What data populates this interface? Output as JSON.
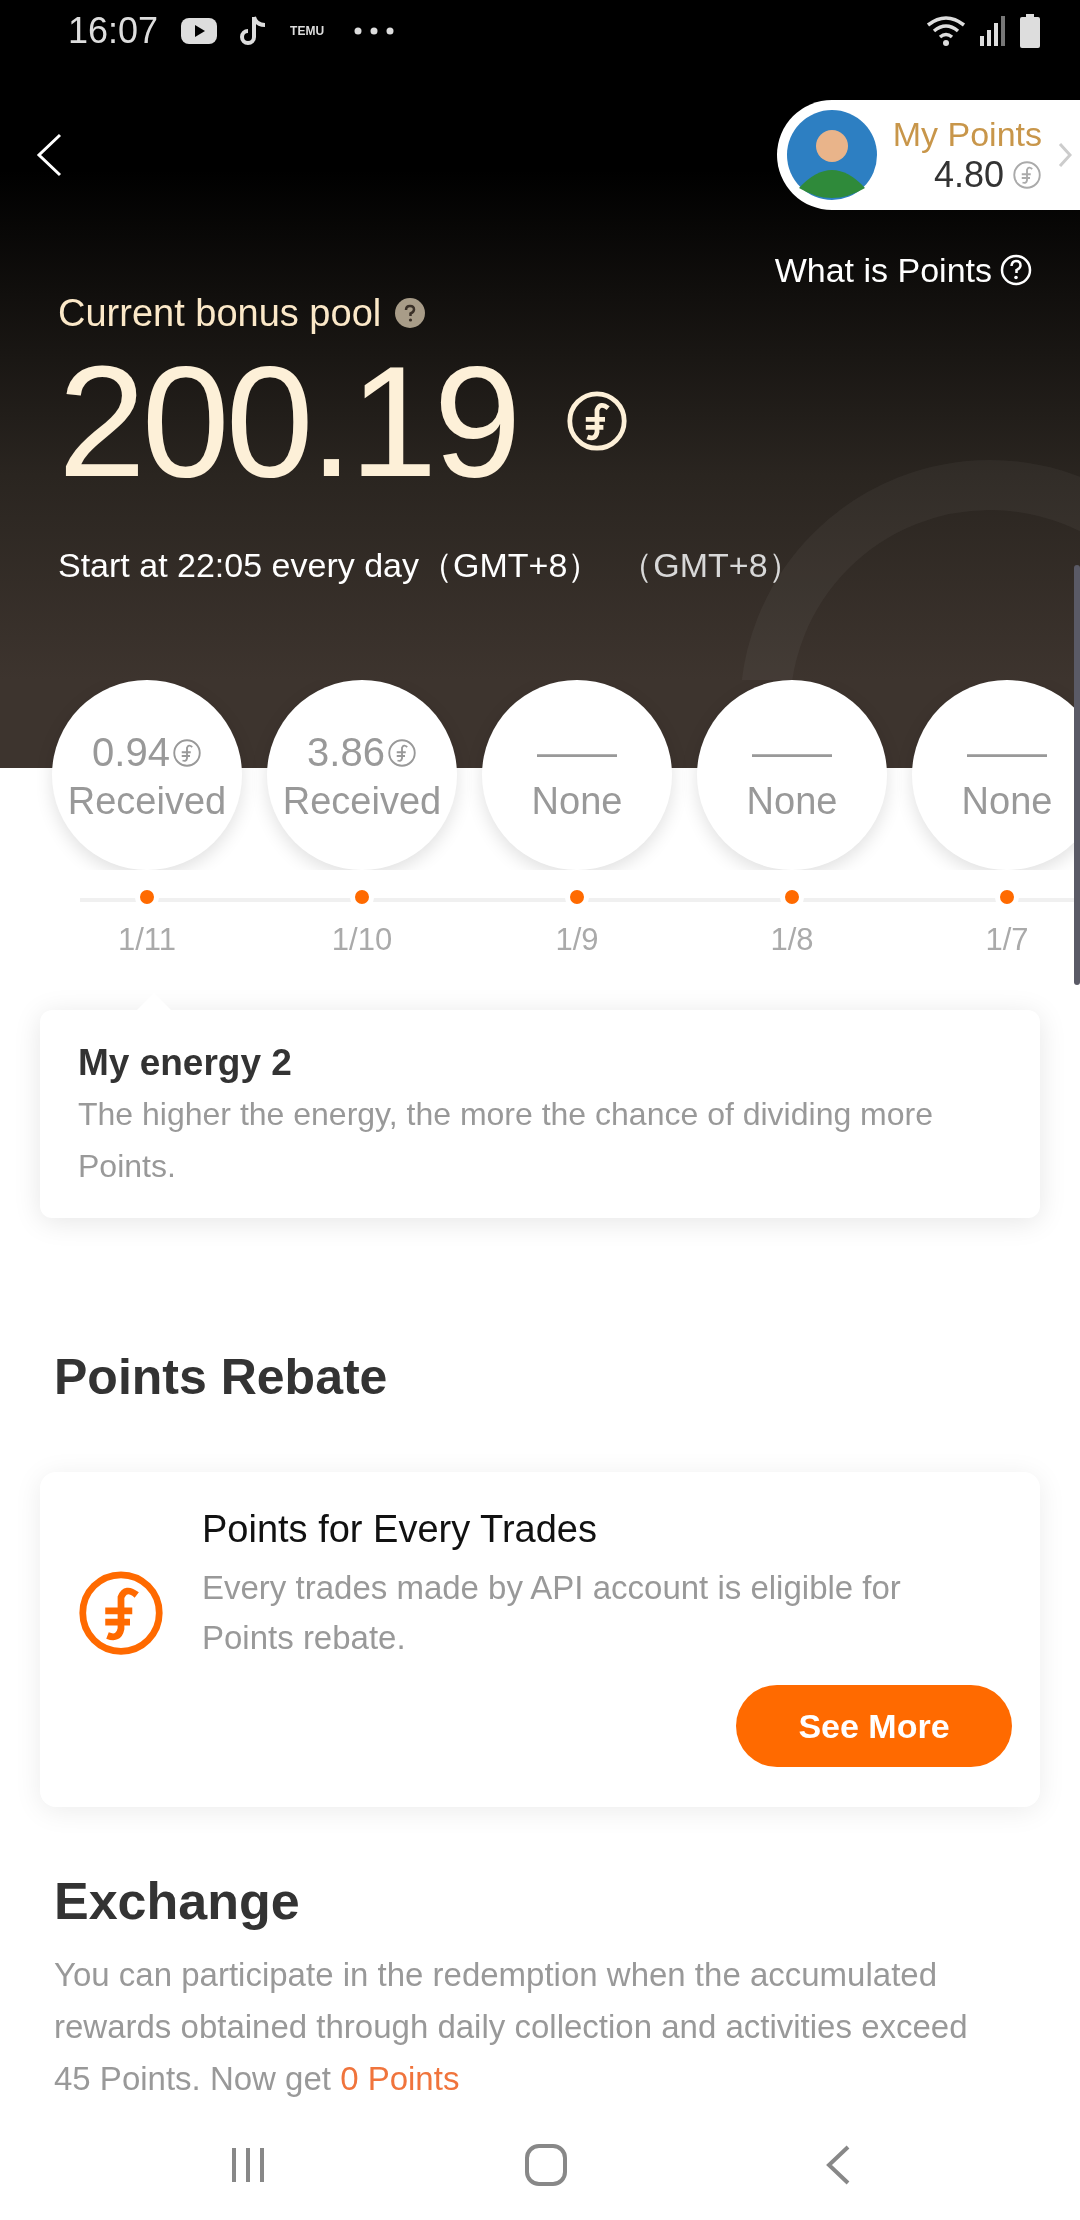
{
  "status_bar": {
    "time": "16:07",
    "notification_label": "TEMU"
  },
  "header": {
    "my_points": {
      "label": "My Points",
      "value": "4.80"
    },
    "help_link": "What is Points"
  },
  "bonus_pool": {
    "title": "Current bonus pool",
    "amount": "200.19",
    "schedule": "Start at 22:05 every day（GMT+8）",
    "timezone": "（GMT+8）"
  },
  "daily_rewards": [
    {
      "kind": "amount",
      "value": "0.94",
      "status": "Received",
      "date": "1/11"
    },
    {
      "kind": "amount",
      "value": "3.86",
      "status": "Received",
      "date": "1/10"
    },
    {
      "kind": "empty",
      "value": "——",
      "status": "None",
      "date": "1/9"
    },
    {
      "kind": "empty",
      "value": "——",
      "status": "None",
      "date": "1/8"
    },
    {
      "kind": "empty",
      "value": "——",
      "status": "None",
      "date": "1/7"
    }
  ],
  "energy": {
    "title": "My energy 2",
    "description": "The higher the energy, the more the chance of dividing more Points."
  },
  "points_rebate": {
    "heading": "Points Rebate",
    "card": {
      "title": "Points for Every Trades",
      "description": "Every trades made by API account is eligible for Points rebate.",
      "button": "See More"
    }
  },
  "exchange": {
    "heading": "Exchange",
    "text": "You can participate in the redemption when the accumulated rewards obtained through daily collection and activities exceed 45 Points. Now get ",
    "highlight": "0 Points"
  }
}
